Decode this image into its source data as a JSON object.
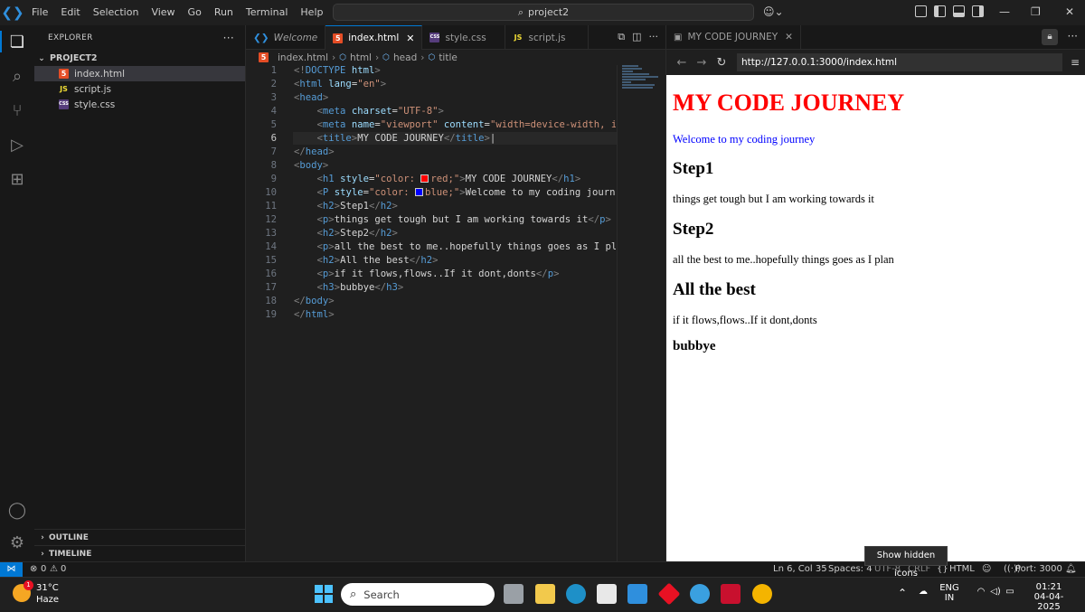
{
  "titlebar": {
    "menu": [
      "File",
      "Edit",
      "Selection",
      "View",
      "Go",
      "Run",
      "Terminal",
      "Help"
    ],
    "command_center": "project2"
  },
  "sidebar": {
    "title": "EXPLORER",
    "project": "PROJECT2",
    "files": [
      {
        "name": "index.html",
        "type": "html"
      },
      {
        "name": "script.js",
        "type": "js"
      },
      {
        "name": "style.css",
        "type": "css"
      }
    ],
    "outline": "OUTLINE",
    "timeline": "TIMELINE"
  },
  "editor": {
    "tabs": [
      {
        "label": "Welcome"
      },
      {
        "label": "index.html"
      },
      {
        "label": "style.css"
      },
      {
        "label": "script.js"
      }
    ],
    "breadcrumb": [
      "index.html",
      "html",
      "head",
      "title"
    ],
    "line_numbers": [
      "1",
      "2",
      "3",
      "4",
      "5",
      "6",
      "7",
      "8",
      "9",
      "10",
      "11",
      "12",
      "13",
      "14",
      "15",
      "16",
      "17",
      "18",
      "19"
    ]
  },
  "preview": {
    "tab_title": "MY CODE JOURNEY",
    "url": "http://127.0.0.1:3000/index.html",
    "page": {
      "h1": "MY CODE JOURNEY",
      "intro": "Welcome to my coding journey",
      "h2_1": "Step1",
      "p1": "things get tough but I am working towards it",
      "h2_2": "Step2",
      "p2": "all the best to me..hopefully things goes as I plan",
      "h2_3": "All the best",
      "p3": "if it flows,flows..If it dont,donts",
      "h3": "bubbye"
    },
    "tooltip": "Show hidden icons"
  },
  "statusbar": {
    "problems": "0",
    "warnings": "0",
    "position": "Ln 6, Col 35",
    "spaces": "Spaces: 4",
    "encoding": "UTF-8",
    "eol": "CRLF",
    "language": "HTML",
    "port": "Port: 3000"
  },
  "taskbar": {
    "weather_temp": "31°C",
    "weather_desc": "Haze",
    "weather_badge": "1",
    "search_placeholder": "Search",
    "lang1": "ENG",
    "lang2": "IN",
    "time": "01:21",
    "date": "04-04-2025"
  }
}
